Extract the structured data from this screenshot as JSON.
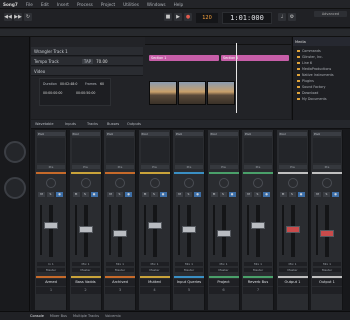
{
  "menu": {
    "logo": "Song7",
    "items": [
      "File",
      "Edit",
      "Insert",
      "Process",
      "Project",
      "Utilities",
      "Windows",
      "Help"
    ]
  },
  "transport": {
    "time": "1:01:000",
    "tempo": "120",
    "layout_button": "Advanced"
  },
  "tracks": [
    {
      "name": "Wrangler Track 1"
    },
    {
      "name": "Tempo Track",
      "tap": "TAP",
      "bpm": "70.00"
    },
    {
      "name": "Video"
    }
  ],
  "clips": [
    "Section 1",
    "Section 2"
  ],
  "video": {
    "duration_label": "Duration",
    "duration": "00:02:48:0",
    "frames_label": "Frames",
    "frames": "60",
    "start": "00:00:00:00",
    "end": "00:00:50:00"
  },
  "browser": {
    "tab": "Media",
    "items": [
      "Commands",
      "Glinster, Inc.",
      "Line 6",
      "MediaProductions",
      "Native Instruments",
      "Plugins",
      "Sound Factory",
      "Download",
      "My Documents"
    ]
  },
  "console": {
    "toolbar": [
      "Wavetable",
      "Inputs",
      "Tracks",
      "Busses",
      "Outputs"
    ],
    "channels": [
      {
        "name": "Armed",
        "color": "#c66a2a",
        "number": "1",
        "input": "In 1",
        "output": "Master",
        "insert": "Pool",
        "send": "Pre"
      },
      {
        "name": "Bass Vadds",
        "color": "#c9a33a",
        "number": "2",
        "input": "Mix 1",
        "output": "Master",
        "insert": "Pool",
        "send": "Pre"
      },
      {
        "name": "Archived",
        "color": "#c66a2a",
        "number": "3",
        "input": "Mix 1",
        "output": "Master",
        "insert": "Pool",
        "send": "Pre"
      },
      {
        "name": "Mutted",
        "color": "#c9a33a",
        "number": "4",
        "input": "Mix 1",
        "output": "Master",
        "insert": "Pool",
        "send": "Pre"
      },
      {
        "name": "Input Queries",
        "color": "#3a8fc4",
        "number": "5",
        "input": "Mix 1",
        "output": "Master",
        "insert": "Pool",
        "send": "Pre"
      },
      {
        "name": "Project",
        "color": "#4aa06a",
        "number": "6",
        "input": "Mix 1",
        "output": "Master",
        "insert": "Pool",
        "send": "Pre"
      },
      {
        "name": "Reverb Bus",
        "color": "#4aa06a",
        "number": "7",
        "input": "Mix 1",
        "output": "Master",
        "insert": "Pool",
        "send": "Pre"
      },
      {
        "name": "Output 1",
        "color": "#c0c0c0",
        "number": "",
        "input": "Mix 1",
        "output": "Master",
        "insert": "Pool",
        "send": "Pre"
      },
      {
        "name": "Output 1",
        "color": "#c0c0c0",
        "number": "",
        "input": "Mix 1",
        "output": "Master",
        "insert": "Pool",
        "send": "Pre"
      }
    ]
  },
  "status": [
    "Console",
    "Mixer Bus",
    "Multiple Tracks",
    "Voicemix"
  ],
  "colors": {
    "accent": "#ffa63d",
    "record": "#e25a4d",
    "monitor": "#3d6fa8"
  }
}
